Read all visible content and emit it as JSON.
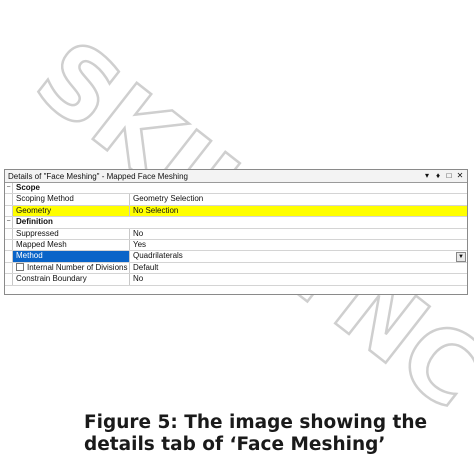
{
  "watermark": {
    "text1": "SKILL",
    "text2": "LYNC"
  },
  "panel": {
    "title": "Details of \"Face Meshing\" - Mapped Face Meshing",
    "title_icons": {
      "pin": "▾",
      "autohide": "♦",
      "maximize": "□",
      "close": "✕"
    },
    "groups": {
      "scope": {
        "label": "Scope",
        "toggle": "−"
      },
      "definition": {
        "label": "Definition",
        "toggle": "−"
      }
    },
    "rows": {
      "scoping_method": {
        "label": "Scoping Method",
        "value": "Geometry Selection"
      },
      "geometry": {
        "label": "Geometry",
        "value": "No Selection"
      },
      "suppressed": {
        "label": "Suppressed",
        "value": "No"
      },
      "mapped_mesh": {
        "label": "Mapped Mesh",
        "value": "Yes"
      },
      "method": {
        "label": "Method",
        "value": "Quadrilaterals"
      },
      "internal_divisions": {
        "label": "Internal Number of Divisions",
        "value": "Default"
      },
      "constrain_boundary": {
        "label": "Constrain Boundary",
        "value": "No"
      }
    },
    "highlight_color": "#ffff00",
    "selected_color": "#0a64c8"
  },
  "caption": {
    "line1": "Figure 5: The image showing the",
    "line2": "details tab of  ‘Face Meshing’"
  }
}
